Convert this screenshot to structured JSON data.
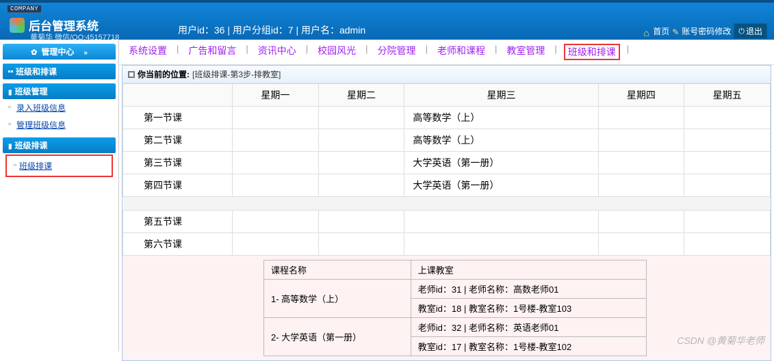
{
  "header": {
    "company": "COMPANY",
    "title": "后台管理系统",
    "sub": "黄菊华  微信/QQ:45157718",
    "userInfo": "用户id：36 | 用户分组id：7 | 用户名：admin",
    "home": "首页",
    "pwd": "账号密码修改",
    "logout": "退出"
  },
  "sidebar": {
    "title": "管理中心",
    "s1": {
      "title": "班级和排课"
    },
    "s2": {
      "title": "班级管理",
      "items": [
        "录入班级信息",
        "管理班级信息"
      ]
    },
    "s3": {
      "title": "班级排课",
      "items": [
        "班级排课"
      ]
    }
  },
  "nav": {
    "items": [
      "系统设置",
      "广告和留言",
      "资讯中心",
      "校园风光",
      "分院管理",
      "老师和课程",
      "教室管理",
      "班级和排课"
    ]
  },
  "breadcrumb": {
    "label": "你当前的位置:",
    "path": "[班级排课-第3步-排教室]"
  },
  "table": {
    "headers": [
      "",
      "星期一",
      "星期二",
      "星期三",
      "星期四",
      "星期五"
    ],
    "rows": [
      {
        "label": "第一节课",
        "cells": [
          "",
          "",
          "高等数学（上）",
          "",
          ""
        ]
      },
      {
        "label": "第二节课",
        "cells": [
          "",
          "",
          "高等数学（上）",
          "",
          ""
        ]
      },
      {
        "label": "第三节课",
        "cells": [
          "",
          "",
          "大学英语（第一册）",
          "",
          ""
        ]
      },
      {
        "label": "第四节课",
        "cells": [
          "",
          "",
          "大学英语（第一册）",
          "",
          ""
        ]
      }
    ],
    "rows2": [
      {
        "label": "第五节课",
        "cells": [
          "",
          "",
          "",
          "",
          ""
        ]
      },
      {
        "label": "第六节课",
        "cells": [
          "",
          "",
          "",
          "",
          ""
        ]
      }
    ]
  },
  "detail": {
    "h1": "课程名称",
    "h2": "上课教室",
    "r1c1": "1- 高等数学（上）",
    "r1c2a": "老师id：31 | 老师名称：高数老师01",
    "r1c2b": "教室id：18 | 教室名称：1号楼-教室103",
    "r2c1": "2- 大学英语（第一册）",
    "r2c2a": "老师id：32 | 老师名称：英语老师01",
    "r2c2b": "教室id：17 | 教室名称：1号楼-教室102"
  },
  "watermark": "CSDN @黄菊华老师"
}
